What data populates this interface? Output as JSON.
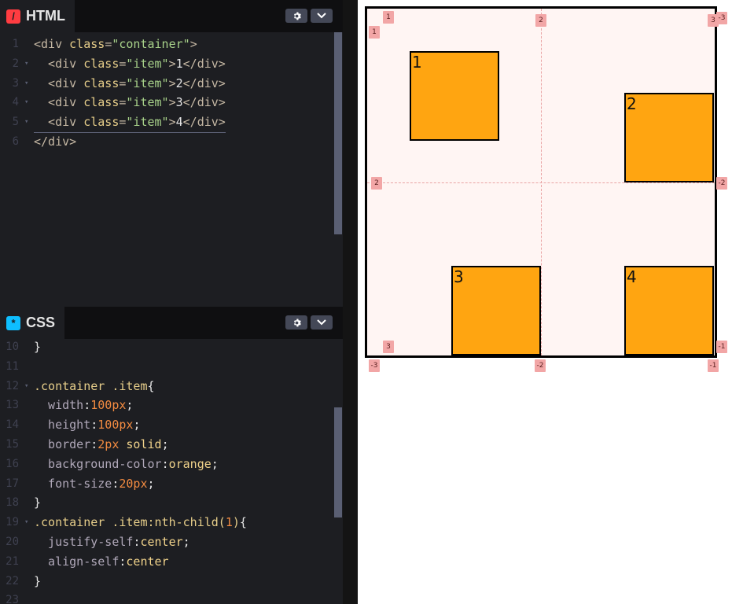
{
  "html_panel": {
    "tab_label": "HTML",
    "icon_glyph": "/",
    "lines": [
      {
        "num": "1",
        "tokens": [
          {
            "c": "tag",
            "t": "<div "
          },
          {
            "c": "attr",
            "t": "class"
          },
          {
            "c": "tag",
            "t": "="
          },
          {
            "c": "str",
            "t": "\"container\""
          },
          {
            "c": "tag",
            "t": ">"
          }
        ]
      },
      {
        "num": "2",
        "tokens": [
          {
            "c": "tag",
            "t": "  <div "
          },
          {
            "c": "attr",
            "t": "class"
          },
          {
            "c": "tag",
            "t": "="
          },
          {
            "c": "str",
            "t": "\"item\""
          },
          {
            "c": "tag",
            "t": ">"
          },
          {
            "c": "txt",
            "t": "1"
          },
          {
            "c": "tag",
            "t": "</div>"
          }
        ]
      },
      {
        "num": "3",
        "tokens": [
          {
            "c": "tag",
            "t": "  <div "
          },
          {
            "c": "attr",
            "t": "class"
          },
          {
            "c": "tag",
            "t": "="
          },
          {
            "c": "str",
            "t": "\"item\""
          },
          {
            "c": "tag",
            "t": ">"
          },
          {
            "c": "txt",
            "t": "2"
          },
          {
            "c": "tag",
            "t": "</div>"
          }
        ]
      },
      {
        "num": "4",
        "tokens": [
          {
            "c": "tag",
            "t": "  <div "
          },
          {
            "c": "attr",
            "t": "class"
          },
          {
            "c": "tag",
            "t": "="
          },
          {
            "c": "str",
            "t": "\"item\""
          },
          {
            "c": "tag",
            "t": ">"
          },
          {
            "c": "txt",
            "t": "3"
          },
          {
            "c": "tag",
            "t": "</div>"
          }
        ]
      },
      {
        "num": "5",
        "tokens": [
          {
            "c": "tag",
            "t": "  <div "
          },
          {
            "c": "attr",
            "t": "class"
          },
          {
            "c": "tag",
            "t": "="
          },
          {
            "c": "str",
            "t": "\"item\""
          },
          {
            "c": "tag",
            "t": ">"
          },
          {
            "c": "txt",
            "t": "4"
          },
          {
            "c": "tag",
            "t": "</div>"
          }
        ]
      },
      {
        "num": "6",
        "tokens": [
          {
            "c": "tag",
            "t": "</div>"
          }
        ]
      }
    ]
  },
  "css_panel": {
    "tab_label": "CSS",
    "icon_glyph": "*",
    "lines": [
      {
        "num": "10",
        "tokens": [
          {
            "c": "pun",
            "t": "}"
          }
        ]
      },
      {
        "num": "11",
        "tokens": []
      },
      {
        "num": "12",
        "tokens": [
          {
            "c": "sel",
            "t": ".container .item"
          },
          {
            "c": "pun",
            "t": "{"
          }
        ]
      },
      {
        "num": "13",
        "tokens": [
          {
            "c": "prop",
            "t": "  width"
          },
          {
            "c": "pun",
            "t": ":"
          },
          {
            "c": "num",
            "t": "100px"
          },
          {
            "c": "pun",
            "t": ";"
          }
        ]
      },
      {
        "num": "14",
        "tokens": [
          {
            "c": "prop",
            "t": "  height"
          },
          {
            "c": "pun",
            "t": ":"
          },
          {
            "c": "num",
            "t": "100px"
          },
          {
            "c": "pun",
            "t": ";"
          }
        ]
      },
      {
        "num": "15",
        "tokens": [
          {
            "c": "prop",
            "t": "  border"
          },
          {
            "c": "pun",
            "t": ":"
          },
          {
            "c": "num",
            "t": "2px"
          },
          {
            "c": "val",
            "t": " solid"
          },
          {
            "c": "pun",
            "t": ";"
          }
        ]
      },
      {
        "num": "16",
        "tokens": [
          {
            "c": "prop",
            "t": "  background-color"
          },
          {
            "c": "pun",
            "t": ":"
          },
          {
            "c": "val",
            "t": "orange"
          },
          {
            "c": "pun",
            "t": ";"
          }
        ]
      },
      {
        "num": "17",
        "tokens": [
          {
            "c": "prop",
            "t": "  font-size"
          },
          {
            "c": "pun",
            "t": ":"
          },
          {
            "c": "num",
            "t": "20px"
          },
          {
            "c": "pun",
            "t": ";"
          }
        ]
      },
      {
        "num": "18",
        "tokens": [
          {
            "c": "pun",
            "t": "}"
          }
        ]
      },
      {
        "num": "19",
        "tokens": [
          {
            "c": "sel",
            "t": ".container .item:nth-child("
          },
          {
            "c": "num",
            "t": "1"
          },
          {
            "c": "sel",
            "t": ")"
          },
          {
            "c": "pun",
            "t": "{"
          }
        ]
      },
      {
        "num": "20",
        "tokens": [
          {
            "c": "prop",
            "t": "  justify-self"
          },
          {
            "c": "pun",
            "t": ":"
          },
          {
            "c": "val",
            "t": "center"
          },
          {
            "c": "pun",
            "t": ";"
          }
        ]
      },
      {
        "num": "21",
        "tokens": [
          {
            "c": "prop",
            "t": "  align-self"
          },
          {
            "c": "pun",
            "t": ":"
          },
          {
            "c": "val",
            "t": "center"
          }
        ]
      },
      {
        "num": "22",
        "tokens": [
          {
            "c": "pun",
            "t": "}"
          }
        ]
      },
      {
        "num": "23",
        "tokens": []
      }
    ]
  },
  "preview": {
    "items": [
      "1",
      "2",
      "3",
      "4"
    ],
    "grid_labels": {
      "top": [
        "1",
        "2",
        "3"
      ],
      "left": [
        "1",
        "2",
        "3"
      ],
      "right": [
        "-3",
        "-2",
        "-1"
      ],
      "bottom": [
        "-3",
        "-2",
        "-1"
      ]
    }
  },
  "colors": {
    "editor_bg": "#1d1e22",
    "item_bg": "#ffa511",
    "grid_label_bg": "#f2a6a6"
  },
  "icons": [
    "settings-gear-icon",
    "chevron-down-icon"
  ]
}
